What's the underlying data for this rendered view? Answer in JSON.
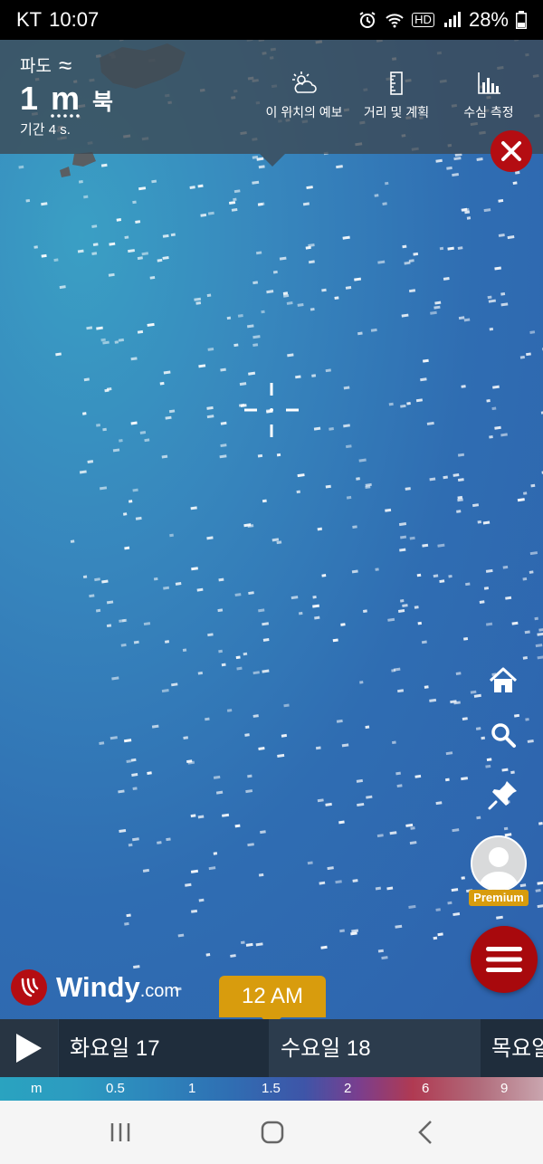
{
  "status_bar": {
    "carrier": "KT",
    "time": "10:07",
    "battery": "28%",
    "hd_label": "HD"
  },
  "wave_panel": {
    "title": "파도",
    "title_symbol": "≈",
    "height_value": "1",
    "height_unit": "m",
    "direction": "북",
    "period": "기간 4 s."
  },
  "toolbar": {
    "forecast_label": "이 위치의 예보",
    "distance_label": "거리 및 계획",
    "sounding_label": "수심 측정"
  },
  "account": {
    "premium_label": "Premium"
  },
  "brand": {
    "name": "Windy",
    "suffix": ".com"
  },
  "timeline": {
    "current_time": "12 AM",
    "days": [
      "화요일 17",
      "수요일 18",
      "목요일"
    ]
  },
  "legend": {
    "labels": [
      "m",
      "0.5",
      "1",
      "1.5",
      "2",
      "6",
      "9"
    ]
  },
  "colors": {
    "accent_red": "#b40d12",
    "accent_gold": "#d89c0d",
    "panel": "#3c4852",
    "sea": "#2f68ad"
  }
}
